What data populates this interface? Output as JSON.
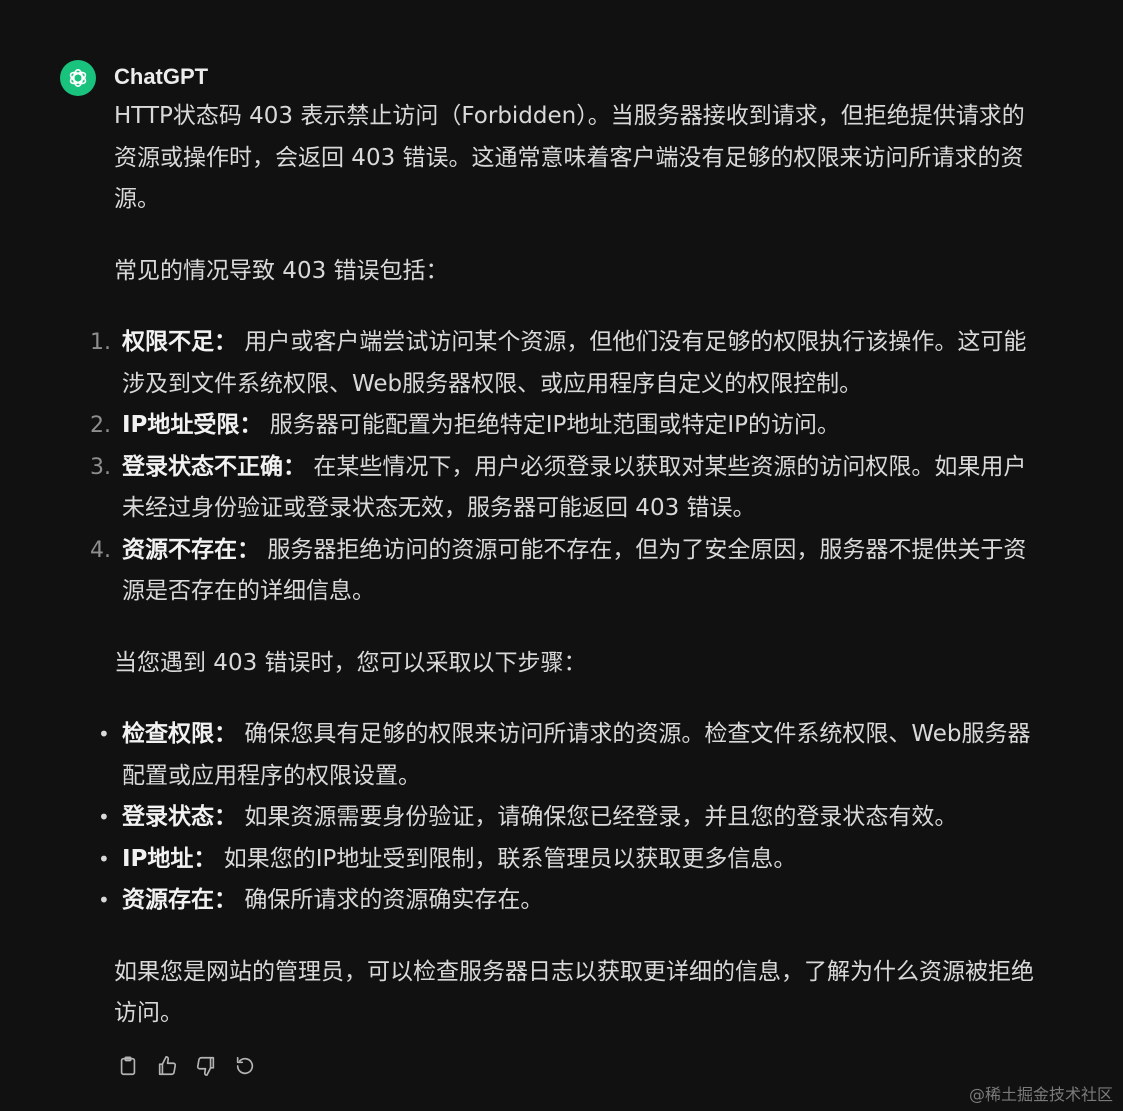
{
  "message": {
    "author": "ChatGPT",
    "avatar_icon": "openai-logo-icon",
    "avatar_color": "#19c37d",
    "intro": "HTTP状态码 403 表示禁止访问（Forbidden）。当服务器接收到请求，但拒绝提供请求的资源或操作时，会返回 403 错误。这通常意味着客户端没有足够的权限来访问所请求的资源。",
    "causes_lead": "常见的情况导致 403 错误包括：",
    "causes": [
      {
        "num": "1.",
        "term": "权限不足：",
        "text": "用户或客户端尝试访问某个资源，但他们没有足够的权限执行该操作。这可能涉及到文件系统权限、Web服务器权限、或应用程序自定义的权限控制。"
      },
      {
        "num": "2.",
        "term": "IP地址受限：",
        "text": "服务器可能配置为拒绝特定IP地址范围或特定IP的访问。"
      },
      {
        "num": "3.",
        "term": "登录状态不正确：",
        "text": "在某些情况下，用户必须登录以获取对某些资源的访问权限。如果用户未经过身份验证或登录状态无效，服务器可能返回 403 错误。"
      },
      {
        "num": "4.",
        "term": "资源不存在：",
        "text": "服务器拒绝访问的资源可能不存在，但为了安全原因，服务器不提供关于资源是否存在的详细信息。"
      }
    ],
    "steps_lead": "当您遇到 403 错误时，您可以采取以下步骤：",
    "steps": [
      {
        "bullet": "•",
        "term": "检查权限：",
        "text": "确保您具有足够的权限来访问所请求的资源。检查文件系统权限、Web服务器配置或应用程序的权限设置。"
      },
      {
        "bullet": "•",
        "term": "登录状态：",
        "text": "如果资源需要身份验证，请确保您已经登录，并且您的登录状态有效。"
      },
      {
        "bullet": "•",
        "term": "IP地址：",
        "text": "如果您的IP地址受到限制，联系管理员以获取更多信息。"
      },
      {
        "bullet": "•",
        "term": "资源存在：",
        "text": "确保所请求的资源确实存在。"
      }
    ],
    "conclusion": "如果您是网站的管理员，可以检查服务器日志以获取更详细的信息，了解为什么资源被拒绝访问。"
  },
  "actions": {
    "copy_icon": "clipboard-icon",
    "like_icon": "thumbs-up-icon",
    "dislike_icon": "thumbs-down-icon",
    "regenerate_icon": "regenerate-icon"
  },
  "watermark": "@稀土掘金技术社区"
}
